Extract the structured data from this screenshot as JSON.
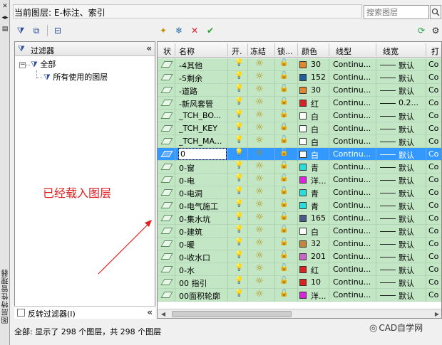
{
  "header": {
    "current_layer_label": "当前图层: E-标注、索引",
    "search_placeholder": "搜索图层"
  },
  "side_rail": {
    "vertical_title": "图层特性管理器"
  },
  "filter_panel": {
    "title": "过滤器",
    "tree": [
      {
        "label": "全部"
      },
      {
        "label": "所有使用的图层"
      }
    ],
    "invert_label": "反转过滤器(I)"
  },
  "columns": [
    "状",
    "名称",
    "开.",
    "冻结",
    "锁...",
    "颜色",
    "线型",
    "线宽",
    "打"
  ],
  "layers": [
    {
      "name": "-4其他",
      "color_name": "30",
      "color": "#e5852a",
      "linetype": "Continu...",
      "lineweight": "默认",
      "plot": "Co",
      "locked": false,
      "selected": false
    },
    {
      "name": "-5剩余",
      "color_name": "152",
      "color": "#1f5f9f",
      "linetype": "Continu...",
      "lineweight": "默认",
      "plot": "Co",
      "locked": false,
      "selected": false
    },
    {
      "name": "-道路",
      "color_name": "30",
      "color": "#e5852a",
      "linetype": "Continu...",
      "lineweight": "默认",
      "plot": "Co",
      "locked": false,
      "selected": false
    },
    {
      "name": "-新风套管",
      "color_name": "红",
      "color": "#e02020",
      "linetype": "Continu...",
      "lineweight": "0.2...",
      "plot": "Co",
      "locked": false,
      "selected": false
    },
    {
      "name": "_TCH_BO...",
      "color_name": "白",
      "color": "#ffffff",
      "linetype": "Continu...",
      "lineweight": "默认",
      "plot": "Co",
      "locked": false,
      "selected": false
    },
    {
      "name": "_TCH_KEY",
      "color_name": "白",
      "color": "#ffffff",
      "linetype": "Continu...",
      "lineweight": "默认",
      "plot": "Co",
      "locked": true,
      "selected": false
    },
    {
      "name": "_TCH_MA...",
      "color_name": "白",
      "color": "#ffffff",
      "linetype": "Continu...",
      "lineweight": "默认",
      "plot": "Co",
      "locked": false,
      "selected": false
    },
    {
      "name": "0",
      "color_name": "白",
      "color": "#ffffff",
      "linetype": "Continu...",
      "lineweight": "默认",
      "plot": "Co",
      "locked": false,
      "selected": true
    },
    {
      "name": "0-窗",
      "color_name": "青",
      "color": "#20e0e0",
      "linetype": "Continu...",
      "lineweight": "默认",
      "plot": "Co",
      "locked": false,
      "selected": false
    },
    {
      "name": "0-电",
      "color_name": "洋...",
      "color": "#e020e0",
      "linetype": "Continu...",
      "lineweight": "默认",
      "plot": "Co",
      "locked": false,
      "selected": false
    },
    {
      "name": "0-电洞",
      "color_name": "青",
      "color": "#20e0e0",
      "linetype": "Continu...",
      "lineweight": "默认",
      "plot": "Co",
      "locked": false,
      "selected": false
    },
    {
      "name": "0-电气施工",
      "color_name": "青",
      "color": "#20e0e0",
      "linetype": "Continu...",
      "lineweight": "默认",
      "plot": "Co",
      "locked": false,
      "selected": false
    },
    {
      "name": "0-集水坑",
      "color_name": "165",
      "color": "#4a5a8a",
      "linetype": "Continu...",
      "lineweight": "默认",
      "plot": "Co",
      "locked": false,
      "selected": false
    },
    {
      "name": "0-建筑",
      "color_name": "白",
      "color": "#ffffff",
      "linetype": "Continu...",
      "lineweight": "默认",
      "plot": "Co",
      "locked": false,
      "selected": false
    },
    {
      "name": "0-暖",
      "color_name": "32",
      "color": "#c8843a",
      "linetype": "Continu...",
      "lineweight": "默认",
      "plot": "Co",
      "locked": false,
      "selected": false
    },
    {
      "name": "0-收水口",
      "color_name": "201",
      "color": "#d060d0",
      "linetype": "Continu...",
      "lineweight": "默认",
      "plot": "Co",
      "locked": false,
      "selected": false
    },
    {
      "name": "0-水",
      "color_name": "红",
      "color": "#e02020",
      "linetype": "Continu...",
      "lineweight": "默认",
      "plot": "Co",
      "locked": false,
      "selected": false
    },
    {
      "name": "00 指引",
      "color_name": "10",
      "color": "#e02020",
      "linetype": "Continu...",
      "lineweight": "默认",
      "plot": "Co",
      "locked": false,
      "selected": false
    },
    {
      "name": "00面积轮廓",
      "color_name": "洋...",
      "color": "#e020e0",
      "linetype": "Continu...",
      "lineweight": "默认",
      "plot": "Co",
      "locked": false,
      "selected": false
    }
  ],
  "status": "全部: 显示了 298 个图层，共 298 个图层",
  "annotation": "已经载入图层",
  "watermark": "CAD自学网"
}
